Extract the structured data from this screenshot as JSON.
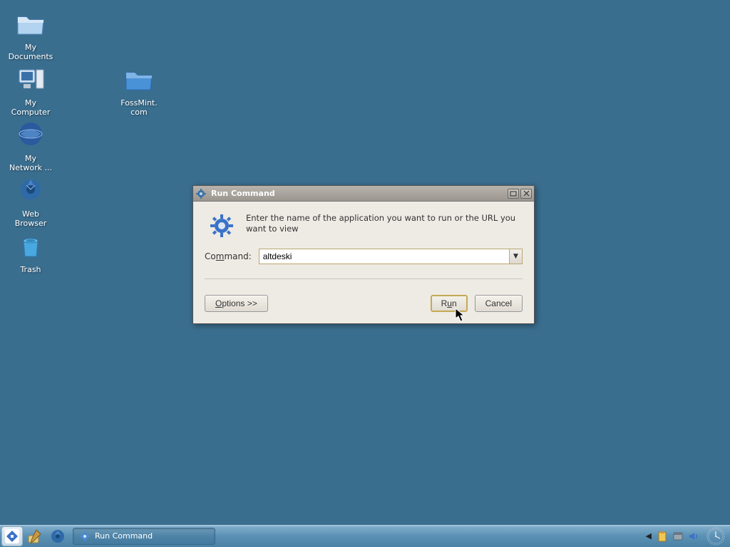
{
  "desktop": {
    "icons": [
      {
        "name": "my-documents",
        "label": "My\nDocuments"
      },
      {
        "name": "my-computer",
        "label": "My\nComputer"
      },
      {
        "name": "my-network",
        "label": "My\nNetwork ..."
      },
      {
        "name": "web-browser",
        "label": "Web\nBrowser"
      },
      {
        "name": "trash",
        "label": "Trash"
      },
      {
        "name": "fossmint",
        "label": "FossMint.\ncom"
      }
    ]
  },
  "dialog": {
    "title": "Run Command",
    "instruction": "Enter the name of the application you want to run or the URL you want to view",
    "command_label": "Command:",
    "command_value": "altdeski",
    "options_label": "Options >>",
    "run_label": "Run",
    "cancel_label": "Cancel"
  },
  "taskbar": {
    "item_label": "Run Command"
  }
}
